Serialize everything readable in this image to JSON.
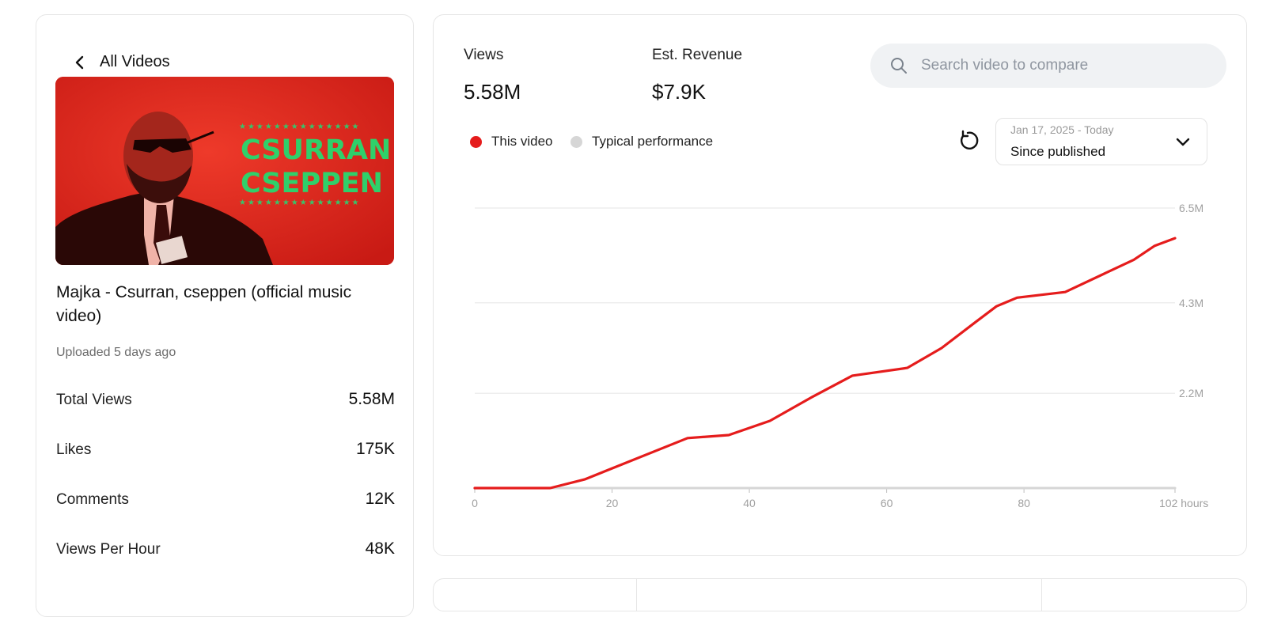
{
  "nav": {
    "back_label": "All Videos"
  },
  "video": {
    "thumbnail_text_1": "CSURRAN",
    "thumbnail_text_2": "CSEPPEN",
    "title": "Majka - Csurran, cseppen (official music video)",
    "uploaded": "Uploaded 5 days ago"
  },
  "stats": [
    {
      "label": "Total Views",
      "value": "5.58M"
    },
    {
      "label": "Likes",
      "value": "175K"
    },
    {
      "label": "Comments",
      "value": "12K"
    },
    {
      "label": "Views Per Hour",
      "value": "48K"
    }
  ],
  "metrics": {
    "views_label": "Views",
    "views_value": "5.58M",
    "revenue_label": "Est. Revenue",
    "revenue_value": "$7.9K"
  },
  "search": {
    "placeholder": "Search video to compare"
  },
  "legend": {
    "this_video": "This video",
    "typical": "Typical performance"
  },
  "date_filter": {
    "range": "Jan 17, 2025 - Today",
    "selected": "Since published"
  },
  "colors": {
    "accent": "#e51c1c",
    "typical": "#d6d6d6",
    "grid": "#e9e9e9",
    "axis_text": "#a0a0a0"
  },
  "icons": {
    "back": "chevron-left-icon",
    "search": "search-icon",
    "refresh": "refresh-icon",
    "dropdown": "chevron-down-icon"
  },
  "chart_data": {
    "type": "line",
    "x_ticks": [
      0,
      20,
      40,
      60,
      80,
      102
    ],
    "x_tick_labels": [
      "0",
      "20",
      "40",
      "60",
      "80",
      "102 hours"
    ],
    "y_ticks": [
      2200000,
      4300000,
      6500000
    ],
    "y_tick_labels": [
      "2.2M",
      "4.3M",
      "6.5M"
    ],
    "xlim": [
      0,
      102
    ],
    "ylim": [
      0,
      6500000
    ],
    "series": [
      {
        "name": "This video",
        "x": [
          0,
          11,
          16,
          31,
          37,
          43,
          49,
          55,
          63,
          68,
          73,
          76,
          79,
          86,
          92,
          96,
          99,
          102
        ],
        "y": [
          0,
          0,
          200000,
          1160000,
          1230000,
          1560000,
          2100000,
          2610000,
          2790000,
          3250000,
          3860000,
          4220000,
          4420000,
          4550000,
          5000000,
          5300000,
          5620000,
          5800000
        ]
      },
      {
        "name": "Typical performance",
        "x": [
          0,
          102
        ],
        "y": [
          0,
          0
        ]
      }
    ],
    "grid": true
  }
}
